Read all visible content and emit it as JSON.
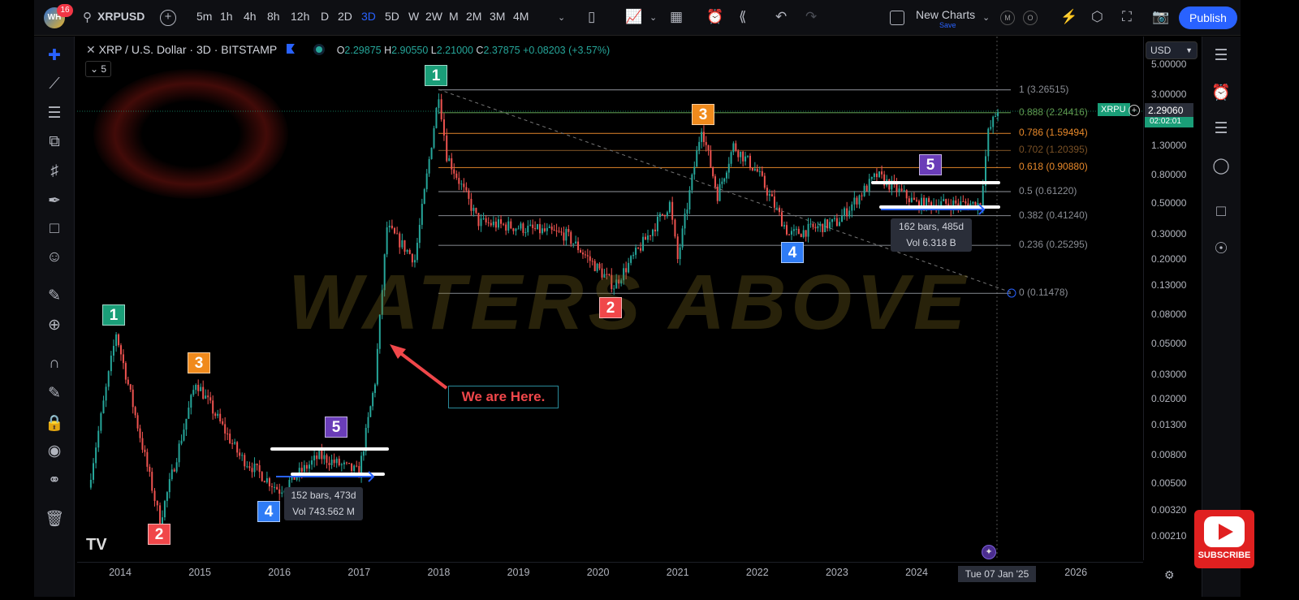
{
  "header": {
    "badge_count": "16",
    "avatar_text": "WH",
    "symbol": "XRPUSD",
    "intervals": [
      "5m",
      "1h",
      "4h",
      "8h",
      "12h",
      "D",
      "2D",
      "3D",
      "5D",
      "W",
      "2W",
      "M",
      "2M",
      "3M",
      "4M"
    ],
    "active_interval": "3D",
    "layout_name": "New Charts",
    "save_label": "Save",
    "m_label": "M",
    "o_label": "O",
    "publish_label": "Publish"
  },
  "legend": {
    "title": "XRP / U.S. Dollar · 3D · BITSTAMP",
    "open_label": "O",
    "open": "2.29875",
    "high_label": "H",
    "high": "2.90550",
    "low_label": "L",
    "low": "2.21000",
    "close_label": "C",
    "close": "2.37875",
    "change": "+0.08203 (+3.57%)",
    "indicators_collapsed": "5"
  },
  "price_axis": {
    "currency": "USD",
    "labels": [
      "5.00000",
      "3.00000",
      "1.30000",
      "0.80000",
      "0.50000",
      "0.30000",
      "0.20000",
      "0.13000",
      "0.08000",
      "0.05000",
      "0.03000",
      "0.02000",
      "0.01300",
      "0.00800",
      "0.00500",
      "0.00320",
      "0.00210"
    ],
    "current_symbol": "XRPU",
    "current_price": "2.29060",
    "countdown": "02:02:01"
  },
  "time_axis": {
    "labels": [
      "2014",
      "2015",
      "2016",
      "2017",
      "2018",
      "2019",
      "2020",
      "2021",
      "2022",
      "2023",
      "2024",
      "2026"
    ],
    "crosshair_date": "Tue 07 Jan '25"
  },
  "colors": {
    "up": "#26a69a",
    "down": "#ef5350",
    "accent": "#2962ff",
    "wave1": "#1a9e78",
    "wave2": "#f0474a",
    "wave3": "#f08a1c",
    "wave4": "#2f7cf6",
    "wave5": "#6a3db8"
  },
  "fib_levels": [
    {
      "text": "1 (3.26515)",
      "ratio": 1,
      "price": 3.26515,
      "color": "#8a8d94"
    },
    {
      "text": "0.888 (2.24416)",
      "ratio": 0.888,
      "price": 2.24416,
      "color": "#5f9a4f"
    },
    {
      "text": "0.786 (1.59494)",
      "ratio": 0.786,
      "price": 1.59494,
      "color": "#e8892a"
    },
    {
      "text": "0.702 (1.20395)",
      "ratio": 0.702,
      "price": 1.20395,
      "color": "#7a5126"
    },
    {
      "text": "0.618 (0.90880)",
      "ratio": 0.618,
      "price": 0.9088,
      "color": "#e8892a"
    },
    {
      "text": "0.5 (0.61220)",
      "ratio": 0.5,
      "price": 0.6122,
      "color": "#8a8d94"
    },
    {
      "text": "0.382 (0.41240)",
      "ratio": 0.382,
      "price": 0.4124,
      "color": "#8a8d94"
    },
    {
      "text": "0.236 (0.25295)",
      "ratio": 0.236,
      "price": 0.25295,
      "color": "#8a8d94"
    },
    {
      "text": "0 (0.11478)",
      "ratio": 0,
      "price": 0.11478,
      "color": "#8a8d94"
    }
  ],
  "annotations": {
    "waves_first": [
      "1",
      "2",
      "3",
      "4",
      "5"
    ],
    "waves_second": [
      "1",
      "2",
      "3",
      "4",
      "5"
    ],
    "callout": "We are Here.",
    "range1_bars": "152 bars, 473d",
    "range1_vol": "Vol 743.562 M",
    "range2_bars": "162 bars, 485d",
    "range2_vol": "Vol 6.318 B",
    "watermark": "WATERS ABOVE",
    "subscribe": "SUBSCRIBE"
  },
  "chart_data": {
    "type": "candlestick",
    "title": "XRP / U.S. Dollar · 3D · BITSTAMP",
    "scale": "log",
    "grid": false,
    "ylim": [
      0.0018,
      5.5
    ],
    "xlim": [
      2013.6,
      2026.3
    ],
    "approx_path": [
      [
        2013.6,
        0.0047
      ],
      [
        2013.95,
        0.06
      ],
      [
        2014.4,
        0.0047
      ],
      [
        2014.5,
        0.0027
      ],
      [
        2014.95,
        0.027
      ],
      [
        2015.5,
        0.0079
      ],
      [
        2016.0,
        0.0045
      ],
      [
        2016.5,
        0.0079
      ],
      [
        2017.0,
        0.006
      ],
      [
        2017.2,
        0.027
      ],
      [
        2017.35,
        0.34
      ],
      [
        2017.7,
        0.2
      ],
      [
        2018.0,
        3.1
      ],
      [
        2018.1,
        1.12
      ],
      [
        2018.5,
        0.37
      ],
      [
        2019.0,
        0.34
      ],
      [
        2019.6,
        0.3
      ],
      [
        2020.2,
        0.13
      ],
      [
        2020.9,
        0.5
      ],
      [
        2021.0,
        0.2
      ],
      [
        2021.3,
        1.8
      ],
      [
        2021.5,
        0.58
      ],
      [
        2021.7,
        1.3
      ],
      [
        2022.0,
        0.85
      ],
      [
        2022.4,
        0.3
      ],
      [
        2023.0,
        0.37
      ],
      [
        2023.5,
        0.8
      ],
      [
        2024.0,
        0.5
      ],
      [
        2024.8,
        0.5
      ],
      [
        2024.9,
        1.6
      ],
      [
        2025.02,
        2.38
      ]
    ]
  }
}
